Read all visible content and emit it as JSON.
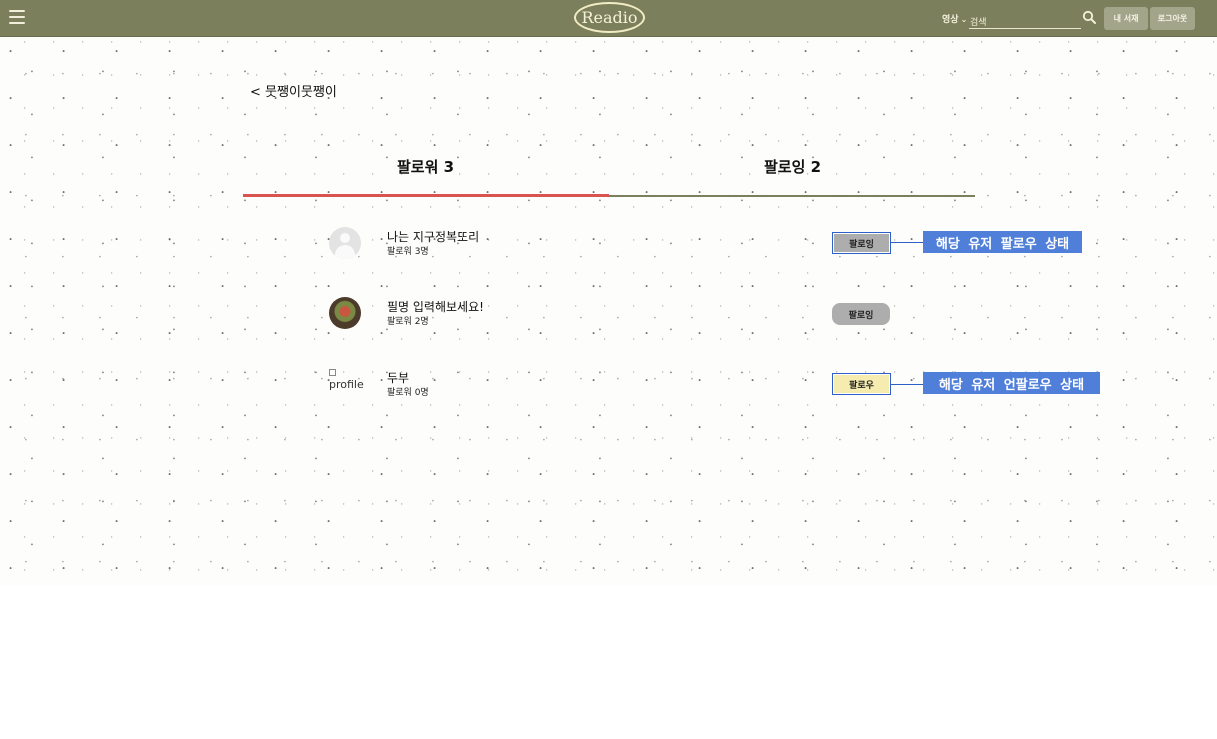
{
  "header": {
    "logo": "Readio",
    "search_type": "영상",
    "search_value": "검색",
    "my_library": "내 서재",
    "logout": "로그아웃"
  },
  "back_label": "< 뭇쨍이뭇쨍이",
  "tabs": [
    {
      "label": "팔로워 3",
      "active": true
    },
    {
      "label": "팔로잉 2",
      "active": false
    }
  ],
  "users": [
    {
      "name": "나는 지구정복또리",
      "count": "팔로워 3명",
      "avatar": "default-avatar",
      "button": "팔로잉"
    },
    {
      "name": "필명 입력해보세요!",
      "count": "팔로워 2명",
      "avatar": "photo-avatar",
      "button": "팔로잉"
    },
    {
      "name": "두부",
      "count": "팔로워 0명",
      "avatar_alt": "profile",
      "button": "팔로우"
    }
  ],
  "annotations": {
    "following_state": "해당 유저 팔로우 상태",
    "unfollowed_state": "해당 유저 언팔로우 상태"
  },
  "colors": {
    "header": "#7c7f5c",
    "active_tab": "#d9534f",
    "annotation": "#4f7fd9",
    "following_button": "#adadad",
    "follow_button": "#f6ecb0"
  }
}
